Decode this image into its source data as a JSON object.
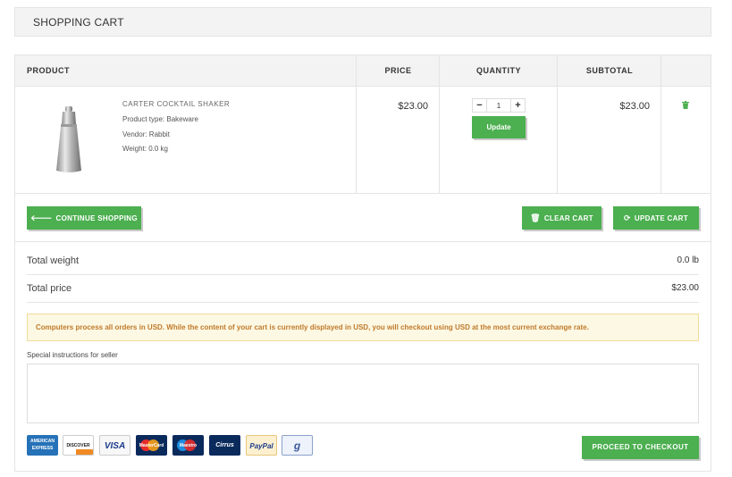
{
  "header": {
    "title": "SHOPPING CART"
  },
  "table": {
    "columns": {
      "product": "PRODUCT",
      "price": "PRICE",
      "quantity": "QUANTITY",
      "subtotal": "SUBTOTAL"
    }
  },
  "item": {
    "name": "CARTER COCKTAIL SHAKER",
    "product_type": "Product type: Bakeware",
    "vendor": "Vendor: Rabbit",
    "weight": "Weight: 0.0 kg",
    "price": "$23.00",
    "quantity": "1",
    "qty_minus": "−",
    "qty_plus": "+",
    "update_label": "Update",
    "subtotal": "$23.00",
    "remove_icon": "trash-icon",
    "image_icon": "cocktail-shaker-image"
  },
  "actions": {
    "continue_label": "CONTINUE SHOPPING",
    "continue_icon": "arrow-left-icon",
    "clear_label": "CLEAR CART",
    "clear_icon": "trash-icon",
    "update_label": "UPDATE CART",
    "update_icon": "refresh-icon"
  },
  "totals": {
    "weight_label": "Total weight",
    "weight_value": "0.0 lb",
    "price_label": "Total price",
    "price_value": "$23.00"
  },
  "notice": "Computers process all orders in USD. While the content of your cart is currently displayed in USD, you will checkout using USD at the most current exchange rate.",
  "instructions": {
    "label": "Special instructions for seller",
    "value": ""
  },
  "payment_icons": {
    "amex": "AMERICAN EXPRESS",
    "discover": "DISCOVER",
    "visa": "VISA",
    "mastercard": "MasterCard",
    "maestro": "Maestro",
    "cirrus": "Cirrus",
    "paypal": "PayPal",
    "google": "g"
  },
  "checkout": {
    "label": "PROCEED TO CHECKOUT"
  },
  "colors": {
    "accent": "#4caf50",
    "notice_bg": "#fcf8e3",
    "notice_text": "#c0792a"
  }
}
